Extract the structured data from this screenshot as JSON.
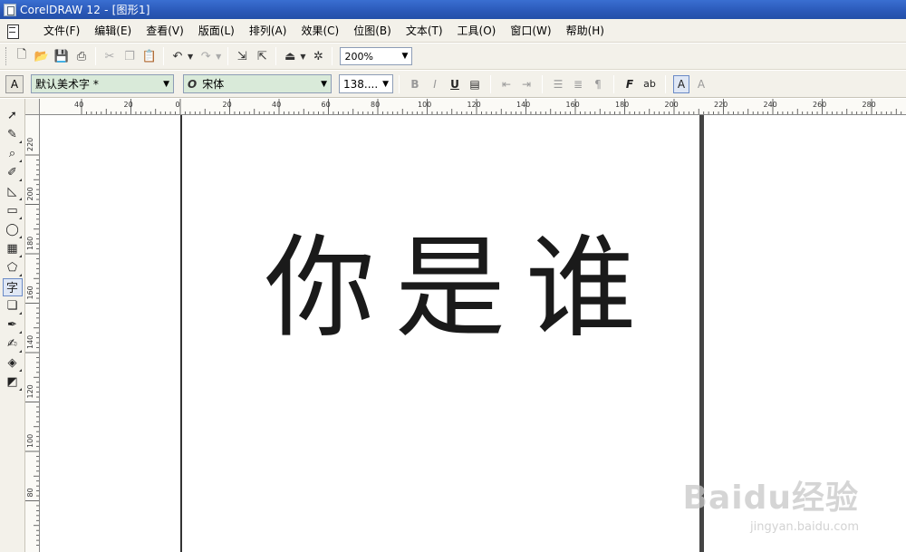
{
  "window": {
    "title": "CorelDRAW 12 - [图形1]"
  },
  "menu": {
    "items": [
      "文件(F)",
      "编辑(E)",
      "查看(V)",
      "版面(L)",
      "排列(A)",
      "效果(C)",
      "位图(B)",
      "文本(T)",
      "工具(O)",
      "窗口(W)",
      "帮助(H)"
    ]
  },
  "toolbar": {
    "zoom_value": "200%",
    "icons": [
      "new-icon",
      "open-icon",
      "save-icon",
      "print-icon",
      "cut-icon",
      "copy-icon",
      "paste-icon",
      "undo-icon",
      "redo-icon",
      "import-icon",
      "export-icon",
      "launch-icon",
      "welcome-icon"
    ]
  },
  "property_bar": {
    "style_label": "默认美术字 *",
    "font_name": "宋体",
    "font_size": "138....",
    "font_glyph": "O"
  },
  "rulers": {
    "top_labels": [
      "40",
      "20",
      "0",
      "20",
      "40",
      "60",
      "80",
      "100",
      "120",
      "140",
      "160",
      "180",
      "200",
      "220",
      "240",
      "260",
      "280"
    ],
    "left_labels": [
      "220",
      "200",
      "180",
      "160",
      "140",
      "120",
      "100",
      "80"
    ]
  },
  "toolbox": {
    "tools": [
      "pick-tool-icon",
      "shape-tool-icon",
      "zoom-tool-icon",
      "freehand-tool-icon",
      "smart-fill-tool-icon",
      "rectangle-tool-icon",
      "ellipse-tool-icon",
      "polygon-tool-icon",
      "basic-shapes-tool-icon",
      "text-tool-icon",
      "interactive-blend-tool-icon",
      "eyedropper-tool-icon",
      "outline-tool-icon",
      "fill-tool-icon",
      "interactive-fill-tool-icon"
    ]
  },
  "canvas": {
    "art_text": "你是谁"
  },
  "watermark": {
    "main": "Baidu经验",
    "sub": "jingyan.baidu.com"
  }
}
